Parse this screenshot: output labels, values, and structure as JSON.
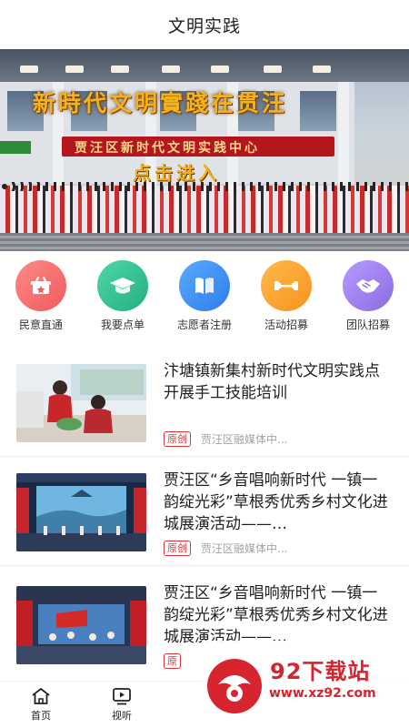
{
  "header": {
    "title": "文明实践"
  },
  "banner": {
    "headline": "新時代文明實踐在贯汪",
    "sign_text": "贾汪区新时代文明实践中心",
    "enter_text": "点击进入"
  },
  "nav": {
    "items": [
      {
        "label": "民意直通",
        "icon": "basket-icon",
        "color": "#f2706f"
      },
      {
        "label": "我要点单",
        "icon": "graduation-cap-icon",
        "color": "#2fbf8f"
      },
      {
        "label": "志愿者注册",
        "icon": "book-icon",
        "color": "#3b8ff0"
      },
      {
        "label": "活动招募",
        "icon": "dumbbell-icon",
        "color": "#f9a22b"
      },
      {
        "label": "团队招募",
        "icon": "handshake-icon",
        "color": "#a384ec"
      }
    ]
  },
  "news": [
    {
      "title": "汴塘镇新集村新时代文明实践点开展手工技能培训",
      "badge": "原创",
      "source": "贾汪区融媒体中..."
    },
    {
      "title": "贾汪区“乡音唱响新时代 一镇一韵绽光彩”草根秀优秀乡村文化进城展演活动——…",
      "badge": "原创",
      "source": "贾汪区融媒体中..."
    },
    {
      "title": "贾汪区“乡音唱响新时代 一镇一韵绽光彩”草根秀优秀乡村文化进城展演活动——…",
      "badge": "原",
      "source": ""
    }
  ],
  "tabbar": {
    "tabs": [
      {
        "label": "首页",
        "icon": "home-icon"
      },
      {
        "label": "视听",
        "icon": "play-screen-icon"
      }
    ]
  },
  "watermark": {
    "name": "92下载站",
    "url": "www.xz92.com"
  },
  "colors": {
    "accent": "#d9353b",
    "watermark": "#d8242f"
  }
}
